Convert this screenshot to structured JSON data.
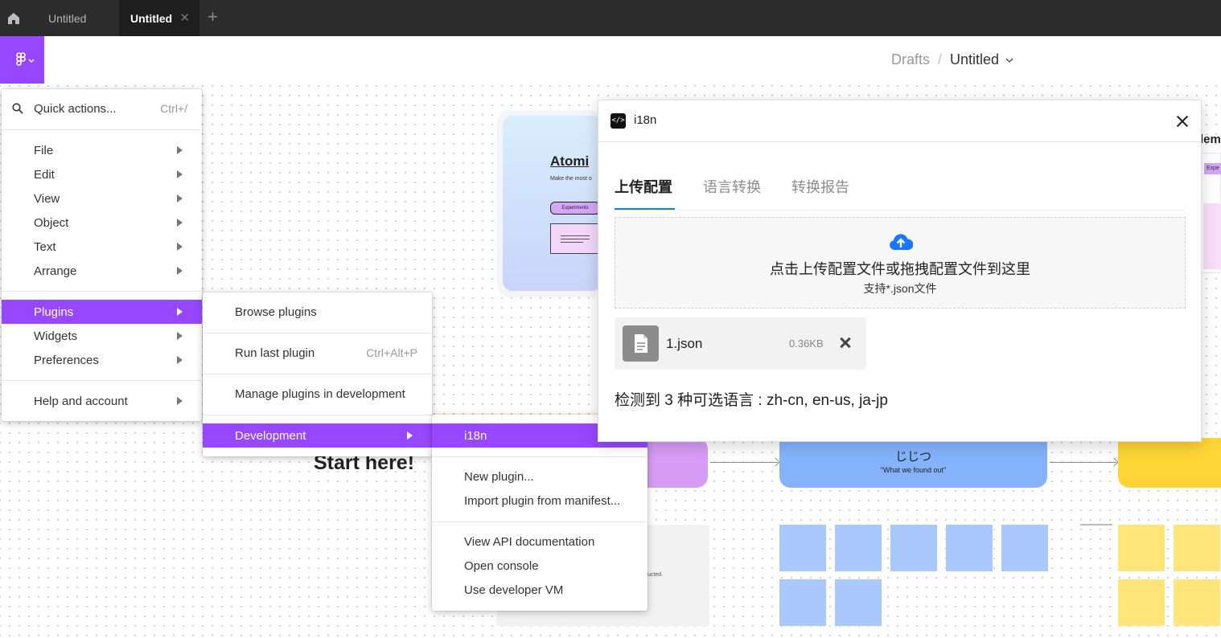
{
  "tabs": [
    {
      "label": "Untitled"
    },
    {
      "label": "Untitled",
      "close": "✕"
    }
  ],
  "new_tab": "+",
  "breadcrumb": {
    "parent": "Drafts",
    "sep": "/",
    "current": "Untitled"
  },
  "main_menu": {
    "search": {
      "label": "Quick actions...",
      "shortcut": "Ctrl+/"
    },
    "items": [
      "File",
      "Edit",
      "View",
      "Object",
      "Text",
      "Arrange",
      "Plugins",
      "Widgets",
      "Preferences",
      "Help and account"
    ]
  },
  "plugins_menu": {
    "browse": "Browse plugins",
    "run_last": "Run last plugin",
    "run_last_shortcut": "Ctrl+Alt+P",
    "manage": "Manage plugins in development",
    "development": "Development"
  },
  "development_menu": {
    "items": [
      "i18n",
      "New plugin...",
      "Import plugin from manifest...",
      "View API documentation",
      "Open console",
      "Use developer VM"
    ]
  },
  "dialog": {
    "icon_text": "</>",
    "title": "i18n",
    "tabs": [
      "上传配置",
      "语言转换",
      "转换报告"
    ],
    "upload_main": "点击上传配置文件或拖拽配置文件到这里",
    "upload_sub": "支持*.json文件",
    "file": {
      "name": "1.json",
      "size": "0.36KB"
    },
    "detect": "检测到 3 种可选语言 : zh-cn, en-us, ja-jp"
  },
  "canvas": {
    "atomic_title": "Atomi",
    "atomic_sub": "Make the most o",
    "experiments_pill": "Experiments",
    "start_here": "Start here!",
    "blue_title": "じじつ",
    "blue_sub": "\"What we found out\"",
    "right_title": "lem",
    "right_pill": "Expe",
    "gray_card_text": "ucted"
  },
  "colors": {
    "accent": "#9747ff",
    "topbar": "#2c2c2c",
    "link_blue": "#1677ff"
  }
}
